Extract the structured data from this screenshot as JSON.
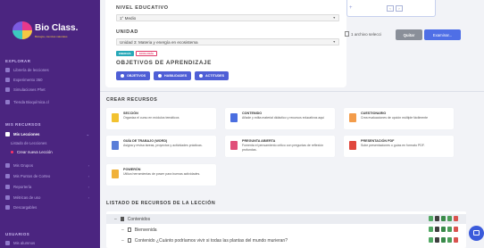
{
  "sidebar": {
    "logo": "Bio Class.",
    "logo_tagline": "Biología, ciencias naturales",
    "sections": {
      "explorar": "EXPLORAR",
      "mis_recursos": "MIS RECURSOS",
      "usuarios": "USUARIOS"
    },
    "explorar_items": [
      {
        "label": "Librería de lecciones",
        "icon": "book-icon"
      },
      {
        "label": "Experimento 360",
        "icon": "cube-icon"
      },
      {
        "label": "Simulaciones Phet",
        "icon": "monitor-icon"
      },
      {
        "label": "Tienda Bioquímica.cl",
        "icon": "cart-icon"
      }
    ],
    "mis_lecciones": {
      "label": "Mis Lecciones",
      "icon": "lesson-icon"
    },
    "sub_items": [
      "Listado de Lecciones",
      "Crear nueva Lección"
    ],
    "more_items": [
      {
        "label": "Mis Grupos",
        "icon": "group-icon"
      },
      {
        "label": "Mis Puntos de Corteo",
        "icon": "points-icon"
      },
      {
        "label": "Reportería",
        "icon": "report-icon"
      },
      {
        "label": "Métricas de uso",
        "icon": "metrics-icon"
      },
      {
        "label": "Descargables",
        "icon": "download-icon"
      }
    ],
    "usuarios_items": [
      {
        "label": "Mis alumnos",
        "icon": "users-icon"
      }
    ]
  },
  "form": {
    "nivel_label": "NIVEL EDUCATIVO",
    "nivel_value": "1° Medio",
    "unidad_label": "UNIDAD",
    "unidad_value": "Unidad 3: Materia y energía en ecosistema",
    "tags": [
      "ENERGÍA",
      "ECOLOGÍA"
    ],
    "objetivos_label": "OBJETIVOS DE APRENDIZAJE",
    "buttons": [
      "OBJETIVOS",
      "HABILIDADES",
      "ACTITUDES"
    ]
  },
  "upload": {
    "file_status": "1 archivo selecci",
    "quitar": "Quitar",
    "examinar": "Examinar..."
  },
  "crear": {
    "title": "CREAR RECURSOS",
    "cards": [
      {
        "title": "SECCIÓN",
        "desc": "Organiza el curso en módulos temáticos",
        "color": "#f2c230"
      },
      {
        "title": "CONTENIDO",
        "desc": "Añade y edita material didáctico y recursos educativos aquí",
        "color": "#4a6ee0"
      },
      {
        "title": "CUESTIONARIO",
        "desc": "Crea evaluaciones de opción múltiple fácilmente",
        "color": "#f39c4a"
      },
      {
        "title": "GUÍA DE TRABAJO (WORD)",
        "desc": "Asigna y revisa tareas, proyectos y actividades prácticas.",
        "color": "#5a7ed8"
      },
      {
        "title": "PREGUNTA ABIERTA",
        "desc": "Fomenta el pensamiento crítico con preguntas de reflexión profundas.",
        "color": "#e0507a"
      },
      {
        "title": "PRESENTACIÓN PDF",
        "desc": "Sube presentaciones o guías en formato PDF.",
        "color": "#e0473d"
      },
      {
        "title": "POWERÓN",
        "desc": "Utiliza herramientas de power para buenas actividades.",
        "color": "#f0b13a"
      }
    ]
  },
  "listado": {
    "title": "LISTADO DE RECURSOS DE LA LECCIÓN",
    "rows": [
      {
        "label": "Contenidos",
        "type": "folder"
      },
      {
        "label": "Bienvenida",
        "type": "doc"
      },
      {
        "label": "Contenido ¿Cuánto podríamos vivir si todas las plantas del mundo murieran?",
        "type": "doc"
      }
    ]
  }
}
